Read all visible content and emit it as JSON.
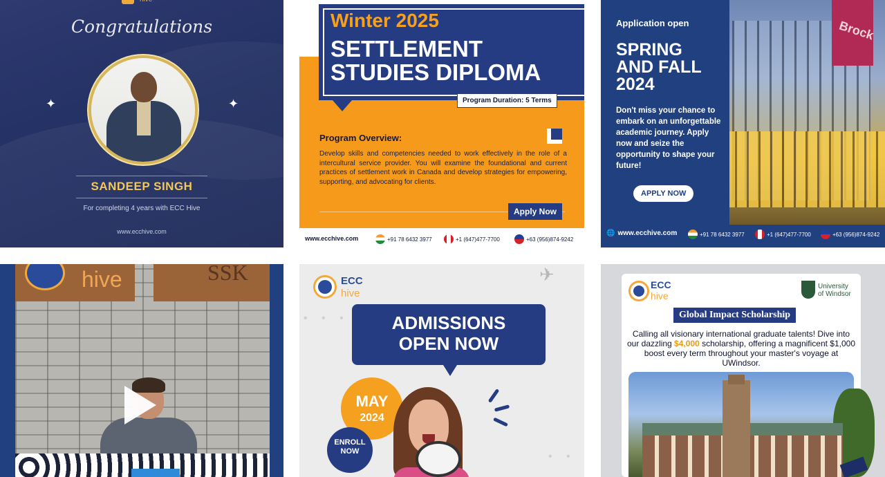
{
  "tiles": {
    "t1": {
      "logo_partial": "hive",
      "heading": "Congratulations",
      "name": "SANDEEP SINGH",
      "subtitle": "For completing 4 years with ECC Hive",
      "website": "www.ecchive.com"
    },
    "t2": {
      "season": "Winter 2025",
      "title_line1": "SETTLEMENT",
      "title_line2": "STUDIES DIPLOMA",
      "duration": "Program Duration: 5 Terms",
      "overview_title": "Program Overview:",
      "overview_text": "Develop skills and competencies needed to work effectively in the role of a intercultural service provider. You will examine the foundational and current practices of settlement work in Canada and develop strategies for empowering, supporting, and advocating for clients.",
      "apply_label": "Apply Now",
      "footer": {
        "website": "www.ecchive.com",
        "india_phone": "+91 78 6432 3977",
        "canada_phone": "+1 (647)477-7700",
        "philippines_phone": "+63 (956)874-9242"
      }
    },
    "t3": {
      "kicker": "Application open",
      "headline_line1": "SPRING",
      "headline_line2": "AND FALL",
      "headline_line3": "2024",
      "body": "Don't miss your chance to embark on an unforgettable academic journey. Apply now and seize the opportunity to shape your future!",
      "apply_label": "APPLY NOW",
      "building_sign": "Brock",
      "footer": {
        "website": "www.ecchive.com",
        "india_phone": "+91 78 6432 3977",
        "canada_phone": "+1 (647)477-7700",
        "philippines_phone": "+63 (956)874-9242"
      }
    },
    "t4": {
      "sign_left": "hive",
      "sign_right": "SSK"
    },
    "t5": {
      "brand_top": "ECC",
      "brand_bottom": "hive",
      "headline_line1": "ADMISSIONS",
      "headline_line2": "OPEN NOW",
      "month": "MAY",
      "year": "2024",
      "enroll_line1": "ENROLL",
      "enroll_line2": "NOW"
    },
    "t6": {
      "brand_top": "ECC",
      "brand_bottom": "hive",
      "uni_line1": "University",
      "uni_line2": "of Windsor",
      "banner": "Global Impact Scholarship",
      "desc_part1": "Calling all visionary international graduate talents! Dive into our dazzling ",
      "amount": "$4,000",
      "desc_part2": " scholarship, offering a magnificent $1,000 boost every term throughout your master's voyage at UWindsor."
    }
  },
  "colors": {
    "navy": "#253c82",
    "orange": "#f59a1b",
    "gold": "#f2c85b",
    "tile1_bg": "#223063",
    "tile3_bg": "#20407f"
  },
  "icons": [
    "play-icon",
    "airplane-icon",
    "megaphone-icon",
    "globe-icon",
    "india-flag-icon",
    "canada-flag-icon",
    "philippines-flag-icon",
    "sparkle-icon"
  ]
}
